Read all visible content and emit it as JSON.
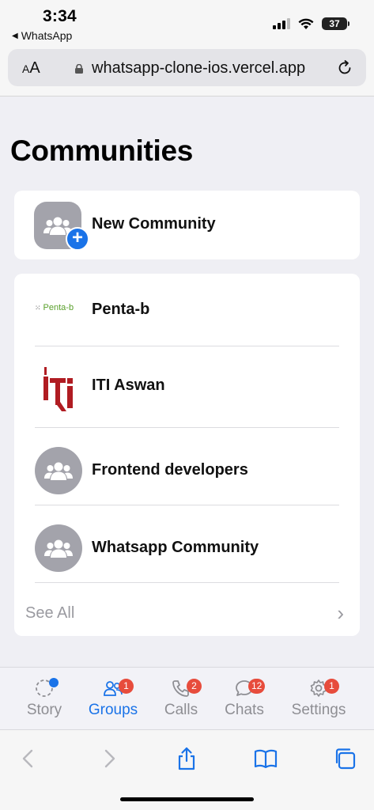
{
  "status_bar": {
    "time": "3:34",
    "back_app": "WhatsApp",
    "battery": "37"
  },
  "browser": {
    "text_size_label_small": "A",
    "text_size_label_large": "A",
    "url": "whatsapp-clone-ios.vercel.app"
  },
  "page": {
    "title": "Communities"
  },
  "new_community": {
    "label": "New Community",
    "plus": "+"
  },
  "communities": [
    {
      "name": "Penta-b",
      "logo_text": "Penta-b"
    },
    {
      "name": "ITI Aswan"
    },
    {
      "name": "Frontend developers"
    },
    {
      "name": "Whatsapp Community"
    }
  ],
  "see_all": {
    "label": "See All",
    "chevron": "›"
  },
  "tabs": [
    {
      "label": "Story",
      "icon": "story-icon",
      "badge": ""
    },
    {
      "label": "Groups",
      "icon": "groups-icon",
      "badge": "1",
      "active": true
    },
    {
      "label": "Calls",
      "icon": "calls-icon",
      "badge": "2"
    },
    {
      "label": "Chats",
      "icon": "chats-icon",
      "badge": "12"
    },
    {
      "label": "Settings",
      "icon": "settings-icon",
      "badge": "1"
    }
  ],
  "colors": {
    "accent": "#1a73e8",
    "badge": "#e74c3c",
    "avatar": "#a3a3ab",
    "iti_red": "#b01c22",
    "penta_green": "#5aa02c"
  }
}
